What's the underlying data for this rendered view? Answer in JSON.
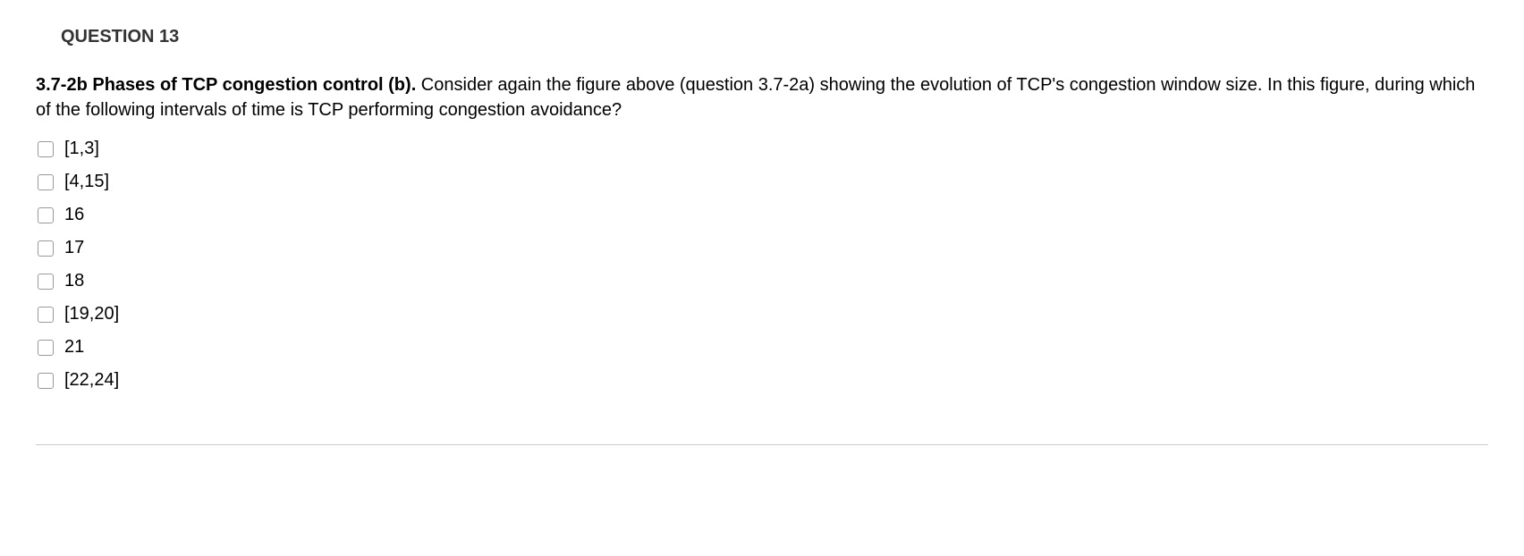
{
  "header": "QUESTION 13",
  "question": {
    "bold_part": "3.7-2b Phases of TCP congestion control (b).",
    "rest": " Consider again the figure above (question 3.7-2a) showing the evolution of TCP's congestion window size. In this figure, during which of the following intervals of time is TCP performing congestion avoidance?"
  },
  "options": [
    {
      "label": "[1,3]"
    },
    {
      "label": "[4,15]"
    },
    {
      "label": "16"
    },
    {
      "label": "17"
    },
    {
      "label": "18"
    },
    {
      "label": "[19,20]"
    },
    {
      "label": "21"
    },
    {
      "label": "[22,24]"
    }
  ]
}
